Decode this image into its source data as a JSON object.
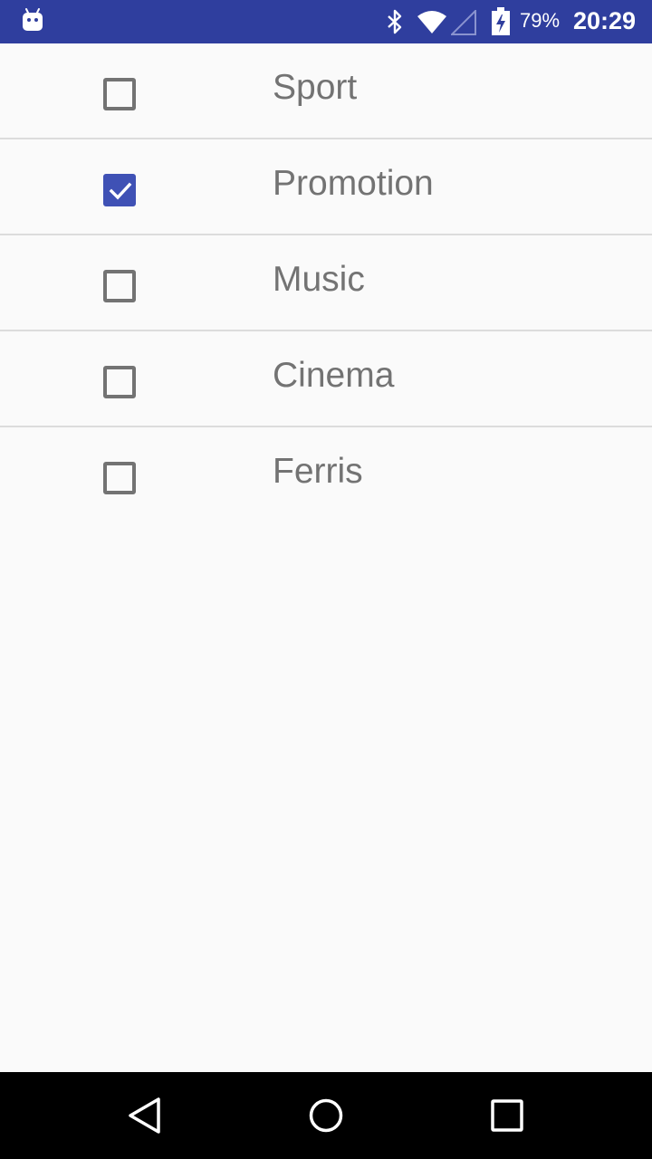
{
  "status_bar": {
    "battery_percent": "79%",
    "time": "20:29",
    "background_color": "#2f3e9e",
    "icons": [
      "android-icon",
      "bluetooth-icon",
      "wifi-icon",
      "cell-signal-icon",
      "battery-charging-icon"
    ]
  },
  "list": {
    "items": [
      {
        "label": "Sport",
        "checked": false
      },
      {
        "label": "Promotion",
        "checked": true
      },
      {
        "label": "Music",
        "checked": false
      },
      {
        "label": "Cinema",
        "checked": false
      },
      {
        "label": "Ferris",
        "checked": false
      }
    ],
    "checkbox_checked_color": "#3f51b5",
    "checkbox_unchecked_color": "#737373",
    "label_color": "#737373"
  },
  "nav_bar": {
    "icons": [
      "back-icon",
      "home-icon",
      "recents-icon"
    ],
    "background_color": "#000000"
  }
}
